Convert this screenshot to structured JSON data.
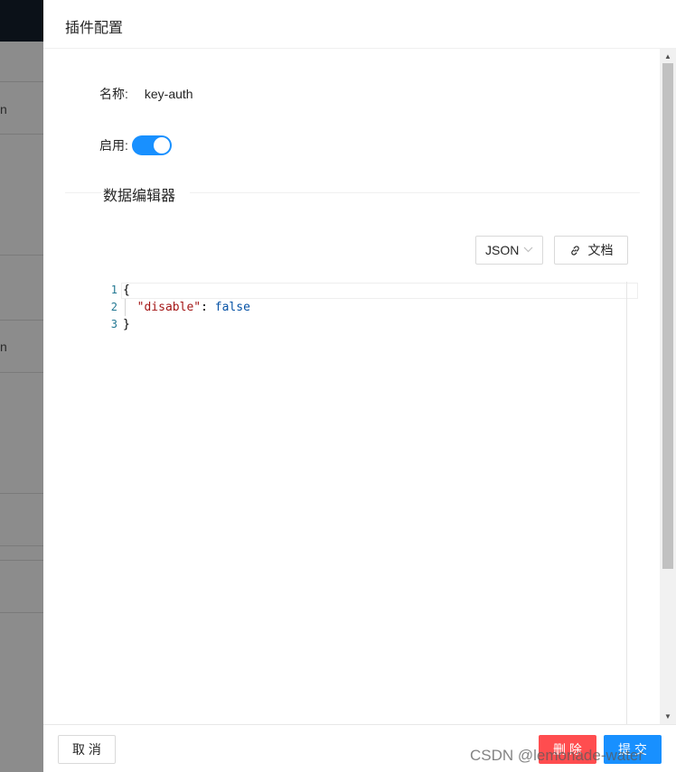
{
  "background": {
    "fragments": [
      "n",
      "n"
    ]
  },
  "drawer": {
    "title": "插件配置",
    "form": {
      "name_label": "名称:",
      "name_value": "key-auth",
      "enable_label": "启用:",
      "enabled": true
    },
    "divider_text": "数据编辑器",
    "toolbar": {
      "format_select": "JSON",
      "docs_label": "文档"
    },
    "editor": {
      "line_numbers": [
        "1",
        "2",
        "3"
      ],
      "lines": {
        "l1": "{",
        "l2_key": "\"disable\"",
        "l2_sep": ": ",
        "l2_value": "false",
        "l3": "}"
      }
    },
    "footer": {
      "cancel_label": "取 消",
      "delete_label": "删 除",
      "submit_label": "提 交"
    },
    "watermark": "CSDN @lemonade-water"
  },
  "colors": {
    "primary": "#1890ff",
    "danger": "#ff4d4f"
  }
}
